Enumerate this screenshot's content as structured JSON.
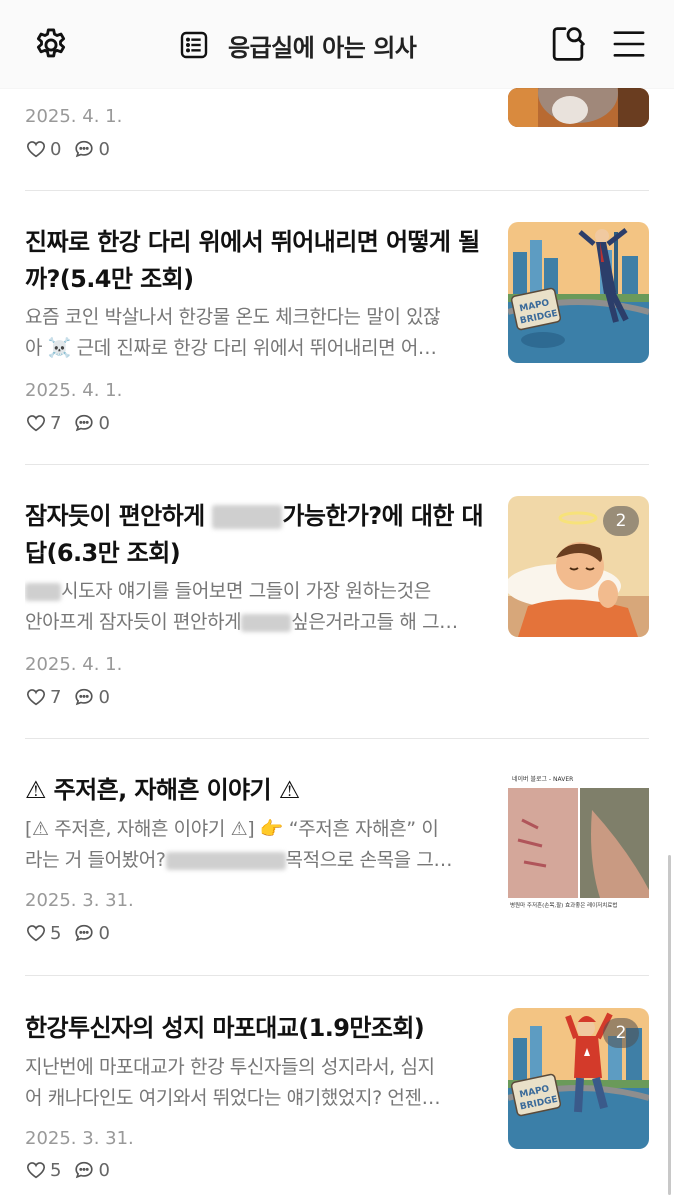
{
  "header": {
    "blog_title": "응급실에 아는 의사",
    "icons": [
      "gear-icon",
      "list-icon",
      "search-icon",
      "menu-icon"
    ]
  },
  "posts": [
    {
      "date": "2025. 4. 1.",
      "likes": "0",
      "comments": "0"
    },
    {
      "title": "진짜로 한강 다리 위에서 뛰어내리면 어떻게 될까?(5.4만 조회)",
      "excerpt_line1": "요즘 코인 박살나서 한강물 온도 체크한다는 말이 있잖",
      "excerpt_line2": "아 ☠️  근데 진짜로 한강 다리 위에서 뛰어내리면 어…",
      "date": "2025. 4. 1.",
      "likes": "7",
      "comments": "0",
      "thumb_text_1": "MAPO",
      "thumb_text_2": "BRIDGE"
    },
    {
      "title_part1": "잠자듯이 편안하게 ",
      "title_part2": "가능한가?에 대한 대답(6.3만 조회)",
      "excerpt_line1_part": "시도자 얘기를 들어보면 그들이 가장 원하는것은",
      "excerpt_line2_part1": "안아프게 잠자듯이 편안하게",
      "excerpt_line2_part2": "싶은거라고들 해 그…",
      "date": "2025. 4. 1.",
      "likes": "7",
      "comments": "0",
      "image_count": "2"
    },
    {
      "title": "⚠ 주저흔, 자해흔 이야기 ⚠",
      "excerpt_line1": "[⚠ 주저흔, 자해흔 이야기 ⚠] 👉  “주저흔 자해흔” 이",
      "excerpt_line2_part1": "라는 거 들어봤어?",
      "excerpt_line2_part2": "목적으로 손목을 그…",
      "date": "2025. 3. 31.",
      "likes": "5",
      "comments": "0",
      "thumb_header": "네이버 블로그 - NAVER",
      "thumb_caption": "병원마 주저흔(손목,팔) 효과좋은 레이저치료법"
    },
    {
      "title": "한강투신자의 성지 마포대교(1.9만조회)",
      "excerpt_line1": "지난번에 마포대교가 한강 투신자들의 성지라서, 심지",
      "excerpt_line2": "어 캐나다인도 여기와서 뛰었다는 얘기했었지? 언젠…",
      "date": "2025. 3. 31.",
      "likes": "5",
      "comments": "0",
      "image_count": "2",
      "thumb_text_1": "MAPO",
      "thumb_text_2": "BRIDGE"
    }
  ],
  "colors": {
    "title": "#111111",
    "excerpt": "#777777",
    "meta": "#999999",
    "divider": "#e6e6e6"
  }
}
